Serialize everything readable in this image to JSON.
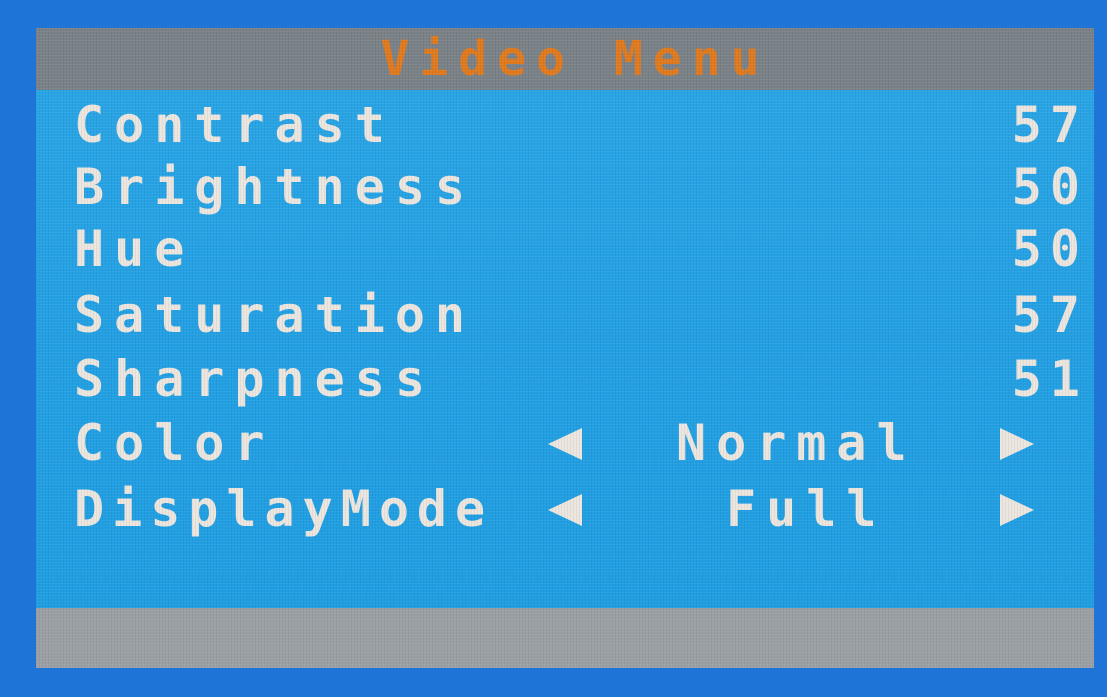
{
  "menu": {
    "title": "Video Menu",
    "items": [
      {
        "label": "Contrast",
        "value": "57"
      },
      {
        "label": "Brightness",
        "value": "50"
      },
      {
        "label": "Hue",
        "value": "50"
      },
      {
        "label": "Saturation",
        "value": "57"
      },
      {
        "label": "Sharpness",
        "value": "51"
      }
    ],
    "options": [
      {
        "label": "Color",
        "value": "Normal"
      },
      {
        "label": "DisplayMode",
        "value": "Full"
      }
    ]
  },
  "colors": {
    "title": "#e07a1e",
    "text": "#ece6df",
    "background": "#23a0e4",
    "title_bar": "#7a8288",
    "footer_bar": "#9aa0a4"
  },
  "icons": {
    "left": "triangle-left-icon",
    "right": "triangle-right-icon"
  }
}
